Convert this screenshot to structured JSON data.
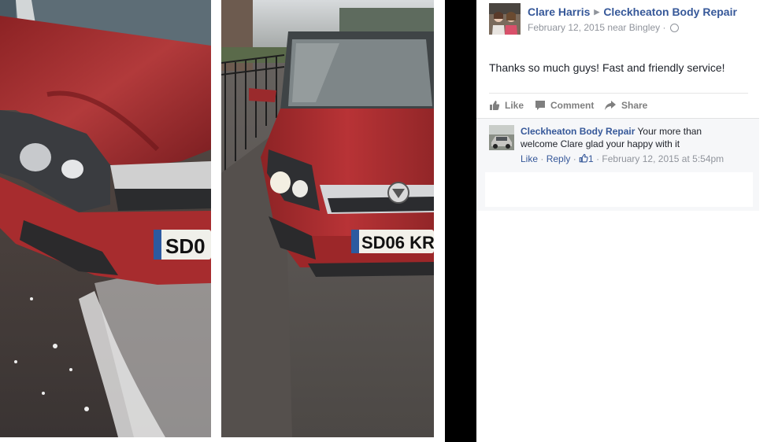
{
  "post": {
    "author": "Clare Harris",
    "page": "Cleckheaton Body Repair",
    "date": "February 12, 2015",
    "location": "near Bingley",
    "separator": "·",
    "text": "Thanks so much guys! Fast and friendly service!"
  },
  "actions": {
    "like": "Like",
    "comment": "Comment",
    "share": "Share"
  },
  "comment": {
    "author": "Cleckheaton Body Repair",
    "text": "Your more than welcome Clare glad your happy with it",
    "like": "Like",
    "reply": "Reply",
    "likes_count": "1",
    "timestamp": "February 12, 2015 at 5:54pm"
  },
  "photos": {
    "left_plate": "SD0",
    "right_plate": "SD06 KR"
  },
  "colors": {
    "link": "#365899",
    "car_red": "#a3282b",
    "meta_gray": "#90949c"
  }
}
